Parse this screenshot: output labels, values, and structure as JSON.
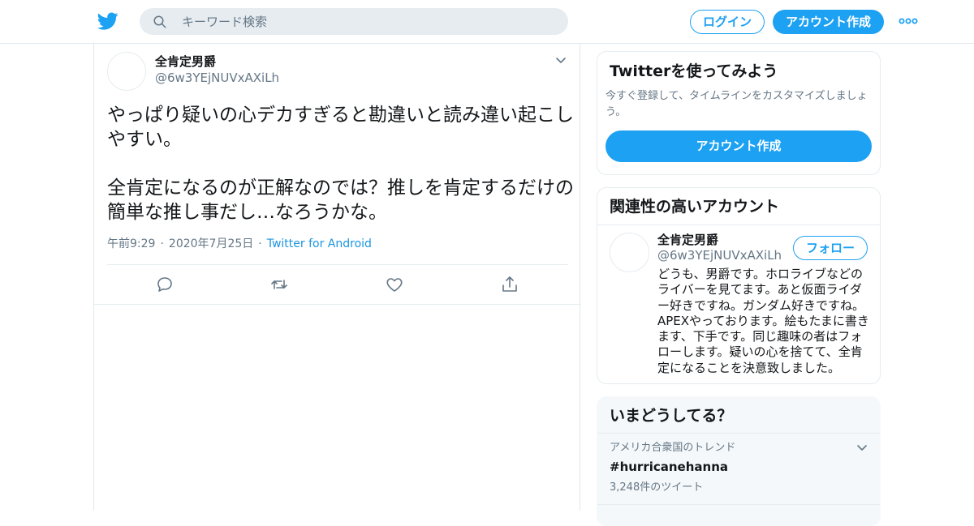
{
  "colors": {
    "accent": "#1da1f2",
    "secondary_text": "#657786",
    "border": "#e6ecf0",
    "link": "#1b95e0"
  },
  "header": {
    "logo_icon": "twitter-bird-icon",
    "search_placeholder": "キーワード検索",
    "login_label": "ログイン",
    "signup_label": "アカウント作成",
    "more_icon": "more-dots-icon"
  },
  "tweet": {
    "author_name": "全肯定男爵",
    "author_handle": "@6w3YEjNUVxAXiLh",
    "text_line1": "やっぱり疑いの心デカすぎると勘違いと読み違い起こしやすい。",
    "text_line2": "全肯定になるのが正解なのでは？推しを肯定するだけの簡単な推し事だし…なろうかな。",
    "time": "午前9:29",
    "date": "2020年7月25日",
    "source": "Twitter for Android",
    "actions": [
      "reply-icon",
      "retweet-icon",
      "like-icon",
      "share-icon"
    ]
  },
  "sidebar": {
    "try_card": {
      "title": "Twitterを使ってみよう",
      "description": "今すぐ登録して、タイムラインをカスタマイズしましょう。",
      "button_label": "アカウント作成"
    },
    "related_card": {
      "title": "関連性の高いアカウント",
      "account_name": "全肯定男爵",
      "account_handle": "@6w3YEjNUVxAXiLh",
      "follow_label": "フォロー",
      "bio": "どうも、男爵です。ホロライブなどのライバーを見てます。あと仮面ライダー好きですね。ガンダム好きですね。APEXやっております。絵もたまに書きます、下手です。同じ趣味の者はフォローします。疑いの心を捨てて、全肯定になることを決意致しました。"
    },
    "trends_card": {
      "title": "いまどうしてる？",
      "trend_context": "アメリカ合衆国のトレンド",
      "trend_name": "#hurricanehanna",
      "trend_count": "3,248件のツイート"
    }
  }
}
